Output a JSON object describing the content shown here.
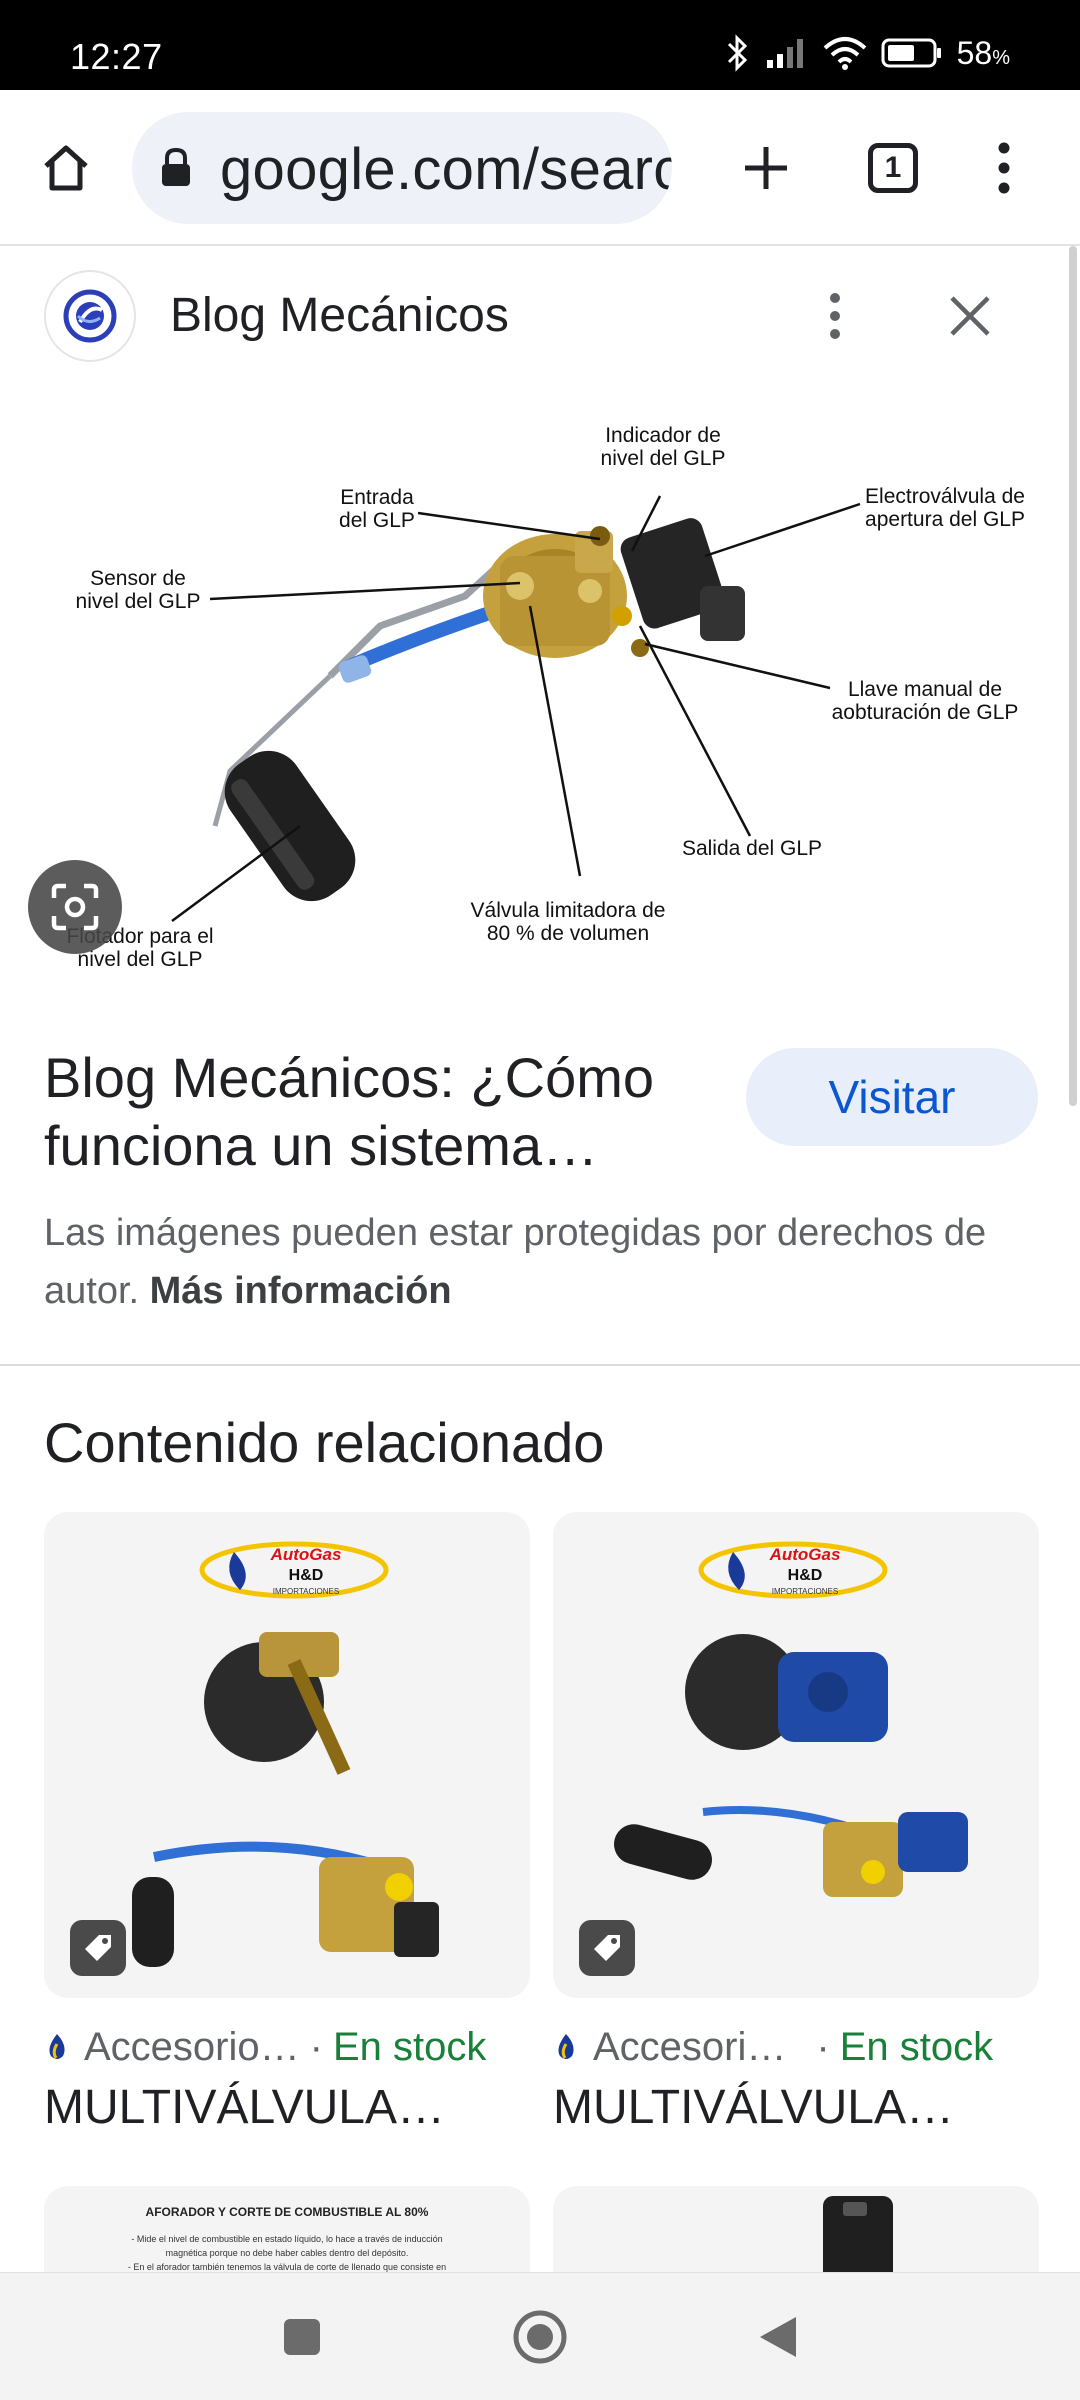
{
  "status_bar": {
    "time": "12:27",
    "battery_percent": "58",
    "battery_unit": "%"
  },
  "browser": {
    "url": "google.com/search",
    "tab_count": "1"
  },
  "source": {
    "name": "Blog Mecánicos"
  },
  "diagram": {
    "labels": {
      "indicador_1": "Indicador de",
      "indicador_2": "nivel del GLP",
      "entrada_1": "Entrada",
      "entrada_2": "del GLP",
      "electro_1": "Electroválvula de",
      "electro_2": "apertura del GLP",
      "sensor_1": "Sensor de",
      "sensor_2": "nivel del GLP",
      "llave_1": "Llave manual de",
      "llave_2": "aobturación de GLP",
      "salida": "Salida del GLP",
      "valvula_1": "Válvula limitadora de",
      "valvula_2": "80 % de volumen",
      "flotador_1": "Flotador para el",
      "flotador_2": "nivel del GLP"
    }
  },
  "result": {
    "title": "Blog Mecánicos: ¿Cómo funciona un sistema…",
    "visit_label": "Visitar",
    "copyright_text": "Las imágenes pueden estar protegidas por derechos de autor.",
    "more_info_label": "Más información"
  },
  "related": {
    "heading": "Contenido relacionado",
    "cards": [
      {
        "shop": "Accesorio…",
        "stock": "En stock",
        "title": "MULTIVÁLVULA…",
        "logo_line1": "AutoGas",
        "logo_line2": "H&D",
        "logo_line3": "IMPORTACIONES"
      },
      {
        "shop": "Accesori…",
        "stock": "En stock",
        "title": "MULTIVÁLVULA…",
        "logo_line1": "AutoGas",
        "logo_line2": "H&D",
        "logo_line3": "IMPORTACIONES"
      }
    ],
    "partial_card_1": {
      "heading": "AFORADOR Y CORTE DE COMBUSTIBLE AL 80%",
      "line1": "- Mide el nivel de combustible en estado líquido, lo hace a través de inducción",
      "line2": "magnética porque no debe haber cables dentro del depósito.",
      "line3": "- En el aforador también tenemos la válvula de corte de llenado que consiste en"
    }
  },
  "colors": {
    "accent_blue": "#0b57d0",
    "stock_green": "#188038",
    "visit_bg": "#e8eefa"
  }
}
